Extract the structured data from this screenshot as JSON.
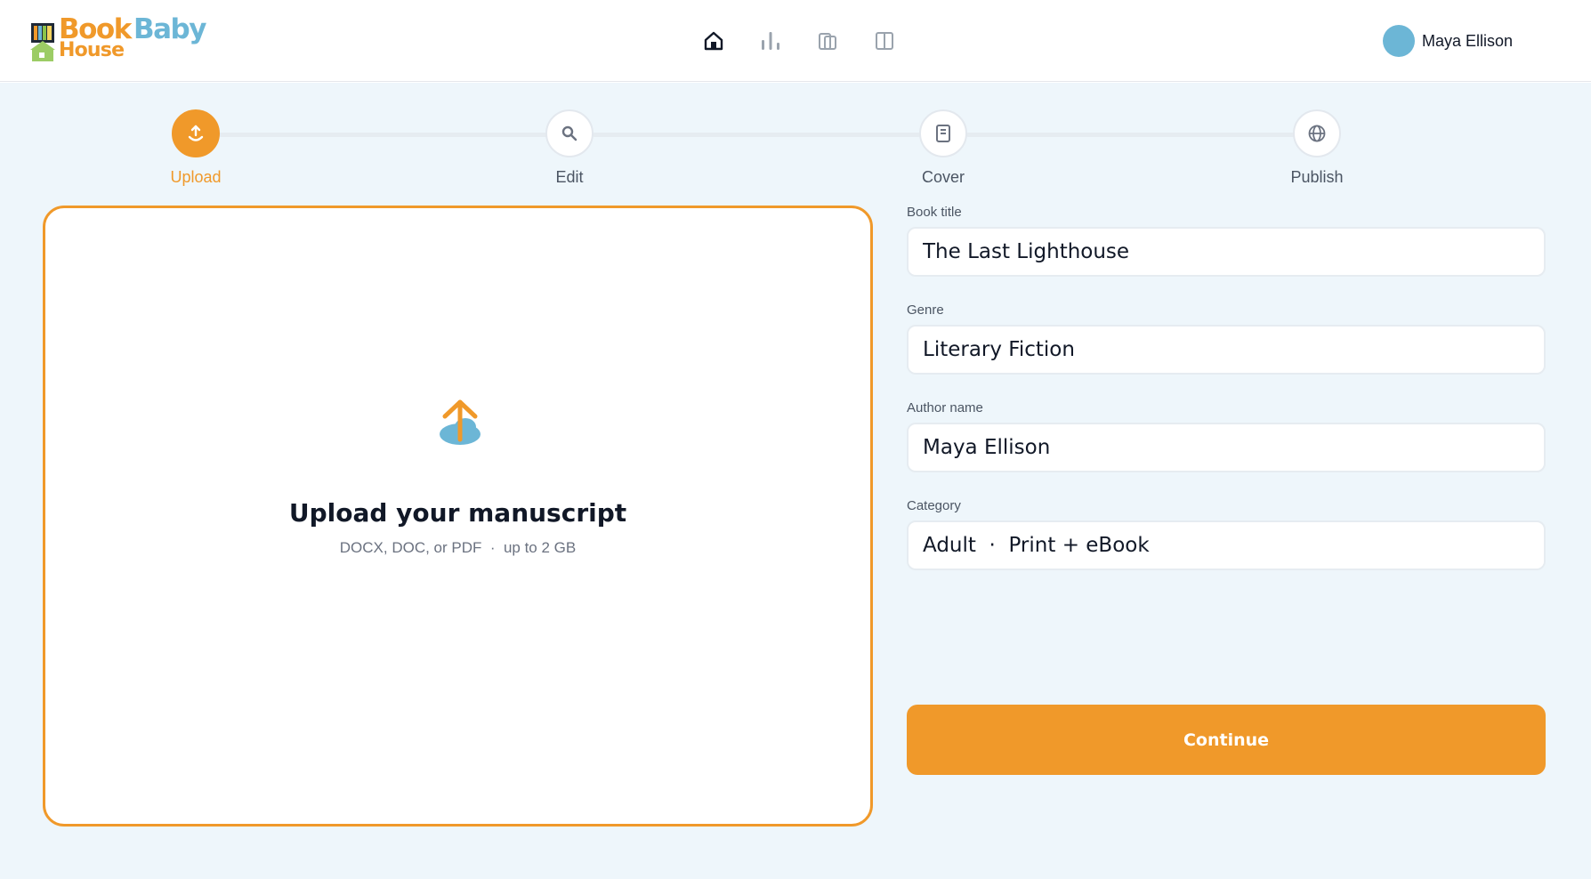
{
  "brand": {
    "logo_word1": "Book",
    "logo_word2": "Baby",
    "logo_word3": "House",
    "primary_color": "#f0992a",
    "secondary_color": "#6cb6d6"
  },
  "nav": {
    "items": [
      {
        "icon": "home-icon",
        "active": true
      },
      {
        "icon": "bar-chart-icon",
        "active": false
      },
      {
        "icon": "library-icon",
        "active": false
      },
      {
        "icon": "book-open-icon",
        "active": false
      }
    ]
  },
  "user": {
    "name": "Maya Ellison"
  },
  "stepper": {
    "steps": [
      {
        "label": "Upload",
        "icon": "upload-icon",
        "active": true
      },
      {
        "label": "Edit",
        "icon": "search-icon",
        "active": false
      },
      {
        "label": "Cover",
        "icon": "document-icon",
        "active": false
      },
      {
        "label": "Publish",
        "icon": "globe-icon",
        "active": false
      }
    ]
  },
  "upload": {
    "title": "Upload your manuscript",
    "subtitle": "DOCX, DOC, or PDF  ·  up to 2 GB"
  },
  "form": {
    "book_title": {
      "label": "Book title",
      "value": "The Last Lighthouse"
    },
    "genre": {
      "label": "Genre",
      "value": "Literary Fiction"
    },
    "author_name": {
      "label": "Author name",
      "value": "Maya Ellison"
    },
    "category": {
      "label": "Category",
      "value": "Adult  ·  Print + eBook"
    },
    "continue_label": "Continue"
  }
}
